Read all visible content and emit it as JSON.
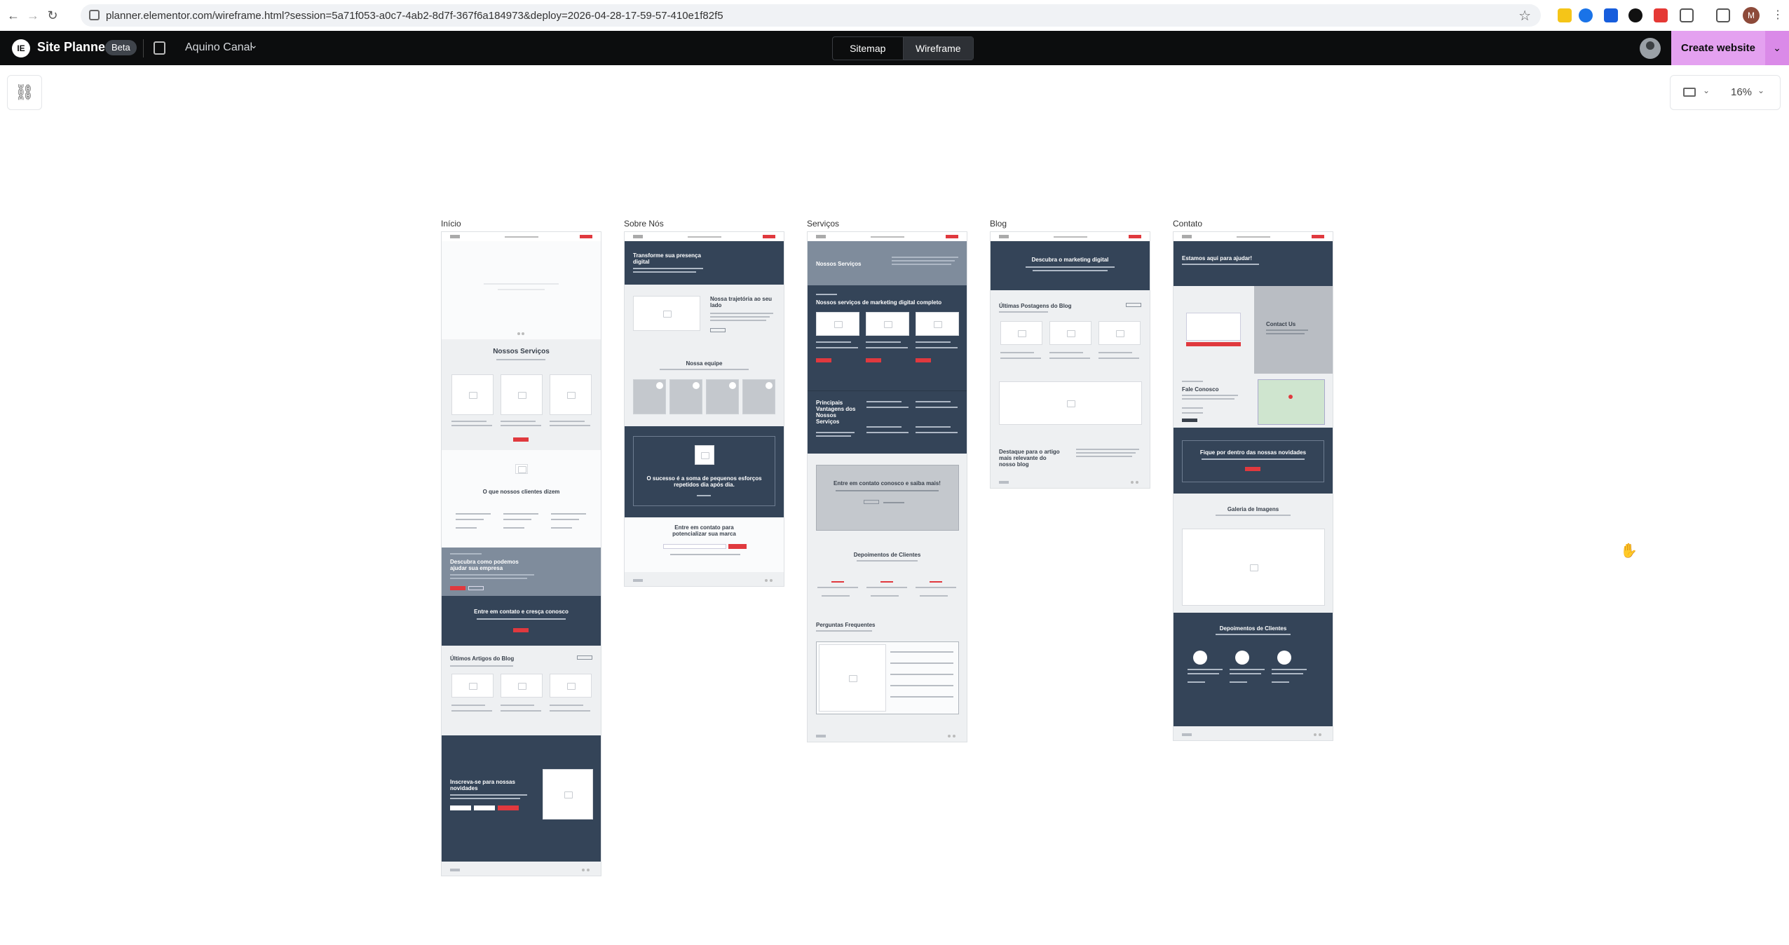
{
  "browser": {
    "url": "planner.elementor.com/wireframe.html?session=5a71f053-a0c7-4ab2-8d7f-367f6a184973&deploy=2026-04-28-17-59-57-410e1f82f5",
    "profile_initial": "M"
  },
  "app": {
    "name": "Site Planner",
    "badge": "Beta",
    "site_name": "Aquino Canal",
    "tabs": [
      {
        "label": "Sitemap",
        "active": false
      },
      {
        "label": "Wireframe",
        "active": true
      }
    ],
    "cta": "Create website"
  },
  "canvas": {
    "zoom": "16%",
    "device": "desktop-icon"
  },
  "pages": [
    {
      "label": "Início",
      "sections": {
        "services": "Nossos Serviços",
        "testimonials": "O que nossos clientes dizem",
        "about": "Descubra como podemos ajudar sua empresa",
        "contact": "Entre em contato e cresça conosco",
        "blog": "Últimos Artigos do Blog",
        "newsletter": "Inscreva-se para nossas novidades"
      }
    },
    {
      "label": "Sobre Nós",
      "sections": {
        "hero": "Transforme sua presença digital",
        "story": "Nossa trajetória ao seu lado",
        "team": "Nossa equipe",
        "quote": "O sucesso é a soma de pequenos esforços repetidos dia após dia.",
        "cta": "Entre em contato para potencializar sua marca"
      }
    },
    {
      "label": "Serviços",
      "sections": {
        "hero": "Nossos Serviços",
        "services": "Nossos serviços de marketing digital completo",
        "benefits": "Principais Vantagens dos Nossos Serviços",
        "cta": "Entre em contato conosco e saiba mais!",
        "testimonials": "Depoimentos de Clientes",
        "faq": "Perguntas Frequentes"
      }
    },
    {
      "label": "Blog",
      "sections": {
        "hero": "Descubra o marketing digital",
        "posts": "Últimas Postagens do Blog",
        "featured": "Destaque para o artigo mais relevante do nosso blog"
      }
    },
    {
      "label": "Contato",
      "sections": {
        "hero": "Estamos aqui para ajudar!",
        "form": "Contact Us",
        "talk": "Fale Conosco",
        "news": "Fique por dentro das nossas novidades",
        "gallery": "Galeria de Imagens",
        "testimonials": "Depoimentos de Clientes"
      }
    }
  ]
}
